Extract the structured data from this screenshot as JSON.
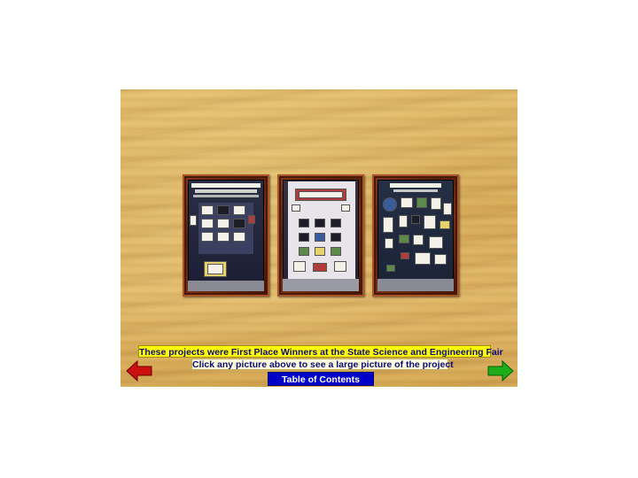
{
  "projects": [
    {
      "label": "project-board-1"
    },
    {
      "label": "project-board-2"
    },
    {
      "label": "project-board-3"
    }
  ],
  "captions": {
    "winners": "These projects were First Place Winners at the State Science and Engineering Fair",
    "instruction": "Click any picture above to see a large picture of the project"
  },
  "nav": {
    "toc_label": "Table of Contents",
    "prev_icon": "left-arrow-icon",
    "next_icon": "right-arrow-icon"
  },
  "colors": {
    "caption_bg": "#ffff00",
    "caption_text": "#0a0a7a",
    "toc_bg": "#0000c8",
    "prev_arrow": "#cc1010",
    "next_arrow": "#1cae18",
    "frame_wood": "#6b2a10",
    "background_wood": "#dcb463"
  }
}
